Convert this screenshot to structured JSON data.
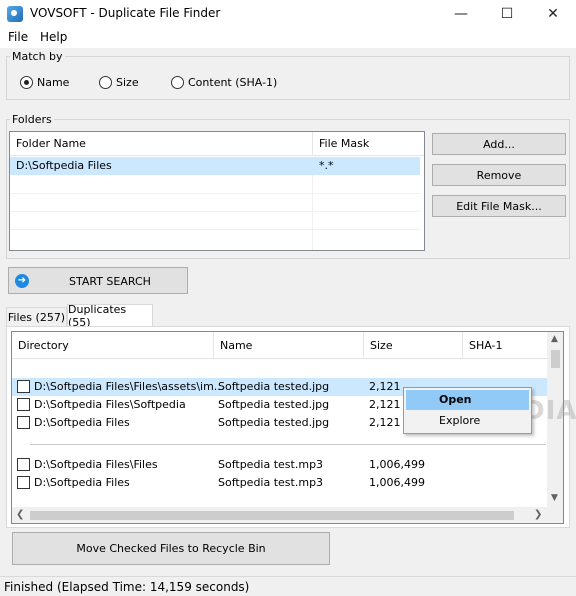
{
  "window": {
    "title": "VOVSOFT - Duplicate File Finder",
    "minimize": "—",
    "maximize": "☐",
    "close": "✕"
  },
  "menu": [
    "File",
    "Help"
  ],
  "match_by": {
    "label": "Match by",
    "options": [
      {
        "label": "Name",
        "selected": true
      },
      {
        "label": "Size",
        "selected": false
      },
      {
        "label": "Content (SHA-1)",
        "selected": false
      }
    ]
  },
  "folders": {
    "label": "Folders",
    "columns": [
      "Folder Name",
      "File Mask"
    ],
    "rows": [
      {
        "folder": "D:\\Softpedia Files",
        "mask": "*.*"
      }
    ],
    "buttons": {
      "add": "Add...",
      "remove": "Remove",
      "edit_mask": "Edit File Mask..."
    }
  },
  "start_search": "START SEARCH",
  "tabs": [
    {
      "label": "Files (257)",
      "active": false
    },
    {
      "label": "Duplicates (55)",
      "active": true
    }
  ],
  "results": {
    "columns": [
      "Directory",
      "Name",
      "Size",
      "SHA-1"
    ],
    "groups": [
      [
        {
          "dir": "D:\\Softpedia Files\\Files\\assets\\im...",
          "name": "Softpedia tested.jpg",
          "size": "2,121",
          "selected": true
        },
        {
          "dir": "D:\\Softpedia Files\\Softpedia",
          "name": "Softpedia tested.jpg",
          "size": "2,121",
          "selected": false
        },
        {
          "dir": "D:\\Softpedia Files",
          "name": "Softpedia tested.jpg",
          "size": "2,121",
          "selected": false
        }
      ],
      [
        {
          "dir": "D:\\Softpedia Files\\Files",
          "name": "Softpedia test.mp3",
          "size": "1,006,499",
          "selected": false
        },
        {
          "dir": "D:\\Softpedia Files",
          "name": "Softpedia test.mp3",
          "size": "1,006,499",
          "selected": false
        }
      ]
    ]
  },
  "context_menu": {
    "items": [
      "Open",
      "Explore"
    ]
  },
  "watermark": "SOFTPEDIA",
  "recycle_button": "Move Checked Files to Recycle Bin",
  "status": "Finished (Elapsed Time: 14,159 seconds)",
  "colors": {
    "selection": "#cce8ff",
    "menu_highlight": "#91c9f7",
    "search_icon": "#1e88e5"
  }
}
